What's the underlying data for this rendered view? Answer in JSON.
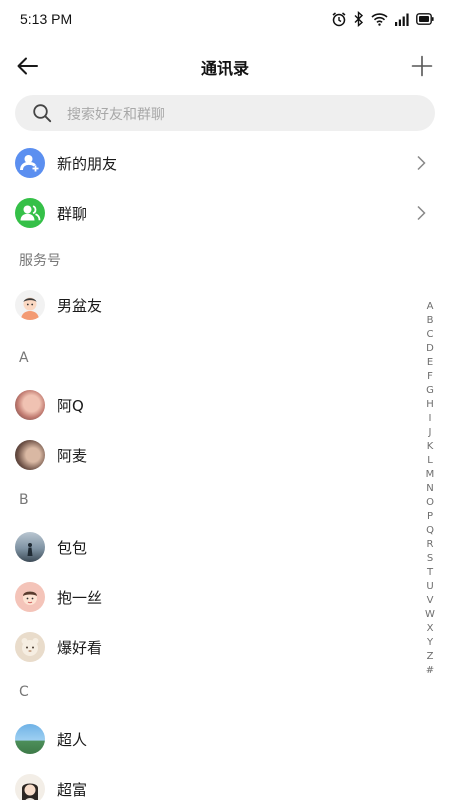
{
  "status_bar": {
    "time": "5:13 PM"
  },
  "nav": {
    "title": "通讯录"
  },
  "search": {
    "placeholder": "搜索好友和群聊"
  },
  "top_items": [
    {
      "label": "新的朋友",
      "icon": "new-friend-icon",
      "color": "#5b8ff0"
    },
    {
      "label": "群聊",
      "icon": "group-chat-icon",
      "color": "#35c048"
    }
  ],
  "service_section": {
    "header": "服务号",
    "items": [
      {
        "name": "男盆友"
      }
    ]
  },
  "sections": [
    {
      "letter": "A",
      "contacts": [
        {
          "name": "阿Q"
        },
        {
          "name": "阿麦"
        }
      ]
    },
    {
      "letter": "B",
      "contacts": [
        {
          "name": "包包"
        },
        {
          "name": "抱一丝"
        },
        {
          "name": "爆好看"
        }
      ]
    },
    {
      "letter": "C",
      "contacts": [
        {
          "name": "超人"
        },
        {
          "name": "超富"
        }
      ]
    }
  ],
  "index_letters": [
    "A",
    "B",
    "C",
    "D",
    "E",
    "F",
    "G",
    "H",
    "I",
    "J",
    "K",
    "L",
    "M",
    "N",
    "O",
    "P",
    "Q",
    "R",
    "S",
    "T",
    "U",
    "V",
    "W",
    "X",
    "Y",
    "Z",
    "#"
  ]
}
